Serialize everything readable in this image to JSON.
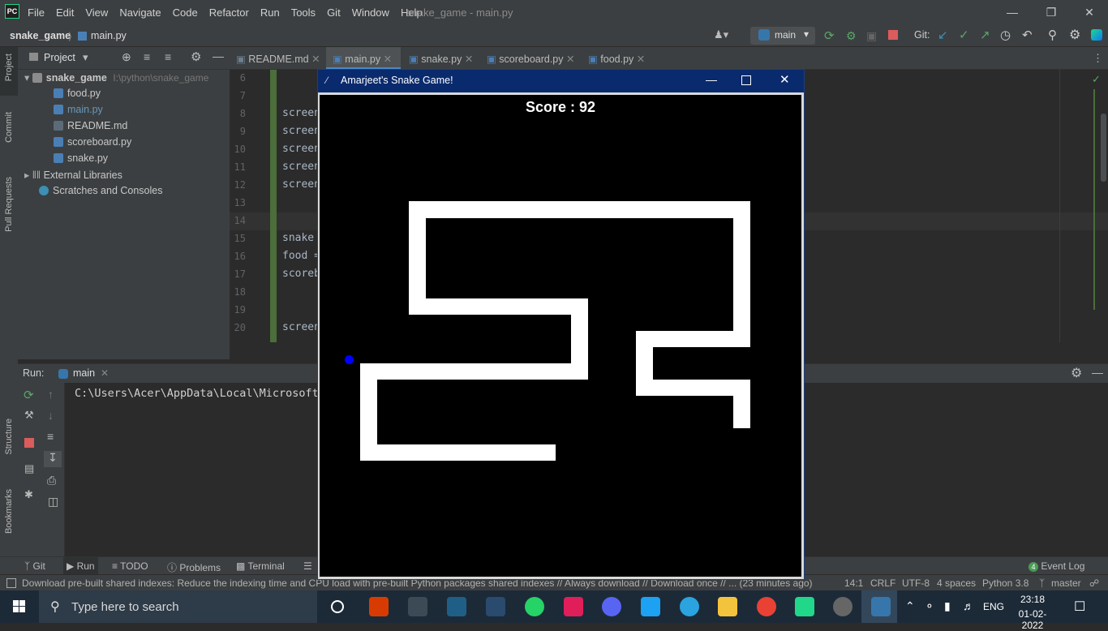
{
  "titlebar": {
    "logo": "PC",
    "menu": [
      "File",
      "Edit",
      "View",
      "Navigate",
      "Code",
      "Refactor",
      "Run",
      "Tools",
      "Git",
      "Window",
      "Help"
    ],
    "window_title": "snake_game - main.py"
  },
  "navbar": {
    "project": "snake_game",
    "file": "main.py",
    "branch": "main",
    "git_label": "Git:"
  },
  "side_tabs": {
    "project": "Project",
    "commit": "Commit",
    "pull_requests": "Pull Requests",
    "structure": "Structure",
    "bookmarks": "Bookmarks"
  },
  "project_panel": {
    "title": "Project",
    "root": "snake_game",
    "root_path": "I:\\python\\snake_game",
    "files": [
      "food.py",
      "main.py",
      "README.md",
      "scoreboard.py",
      "snake.py"
    ],
    "external": "External Libraries",
    "scratches": "Scratches and Consoles"
  },
  "tabs": [
    "README.md",
    "main.py",
    "snake.py",
    "scoreboard.py",
    "food.py"
  ],
  "editor": {
    "lines": [
      {
        "n": "6",
        "code": ""
      },
      {
        "n": "7",
        "code": ""
      },
      {
        "n": "8",
        "code": "screen"
      },
      {
        "n": "9",
        "code": "screen"
      },
      {
        "n": "10",
        "code": "screen"
      },
      {
        "n": "11",
        "code": "screen"
      },
      {
        "n": "12",
        "code": "screen"
      },
      {
        "n": "13",
        "code": ""
      },
      {
        "n": "14",
        "code": ""
      },
      {
        "n": "15",
        "code": "snake "
      },
      {
        "n": "16",
        "code": "food ="
      },
      {
        "n": "17",
        "code": "scoreb"
      },
      {
        "n": "18",
        "code": ""
      },
      {
        "n": "19",
        "code": ""
      },
      {
        "n": "20",
        "code": "screen"
      }
    ]
  },
  "run_panel": {
    "label": "Run:",
    "tab": "main",
    "output": "C:\\Users\\Acer\\AppData\\Local\\Microsoft\\"
  },
  "bottom_bar": {
    "git": "Git",
    "run": "Run",
    "todo": "TODO",
    "problems": "Problems",
    "terminal": "Terminal",
    "event_log": "Event Log",
    "event_count": "4"
  },
  "status": {
    "message": "Download pre-built shared indexes: Reduce the indexing time and CPU load with pre-built Python packages shared indexes // Always download // Download once // ... (23 minutes ago)",
    "position": "14:1",
    "line_sep": "CRLF",
    "encoding": "UTF-8",
    "indent": "4 spaces",
    "interpreter": "Python 3.8",
    "branch": "master"
  },
  "snake_window": {
    "title": "Amarjeet's Snake Game!",
    "score": "Score : 92",
    "snake_color": "#ffffff",
    "food_color": "#0000ff",
    "background": "#000000"
  },
  "taskbar": {
    "search_placeholder": "Type here to search",
    "time": "23:18",
    "date": "01-02-2022",
    "lang": "ENG"
  }
}
